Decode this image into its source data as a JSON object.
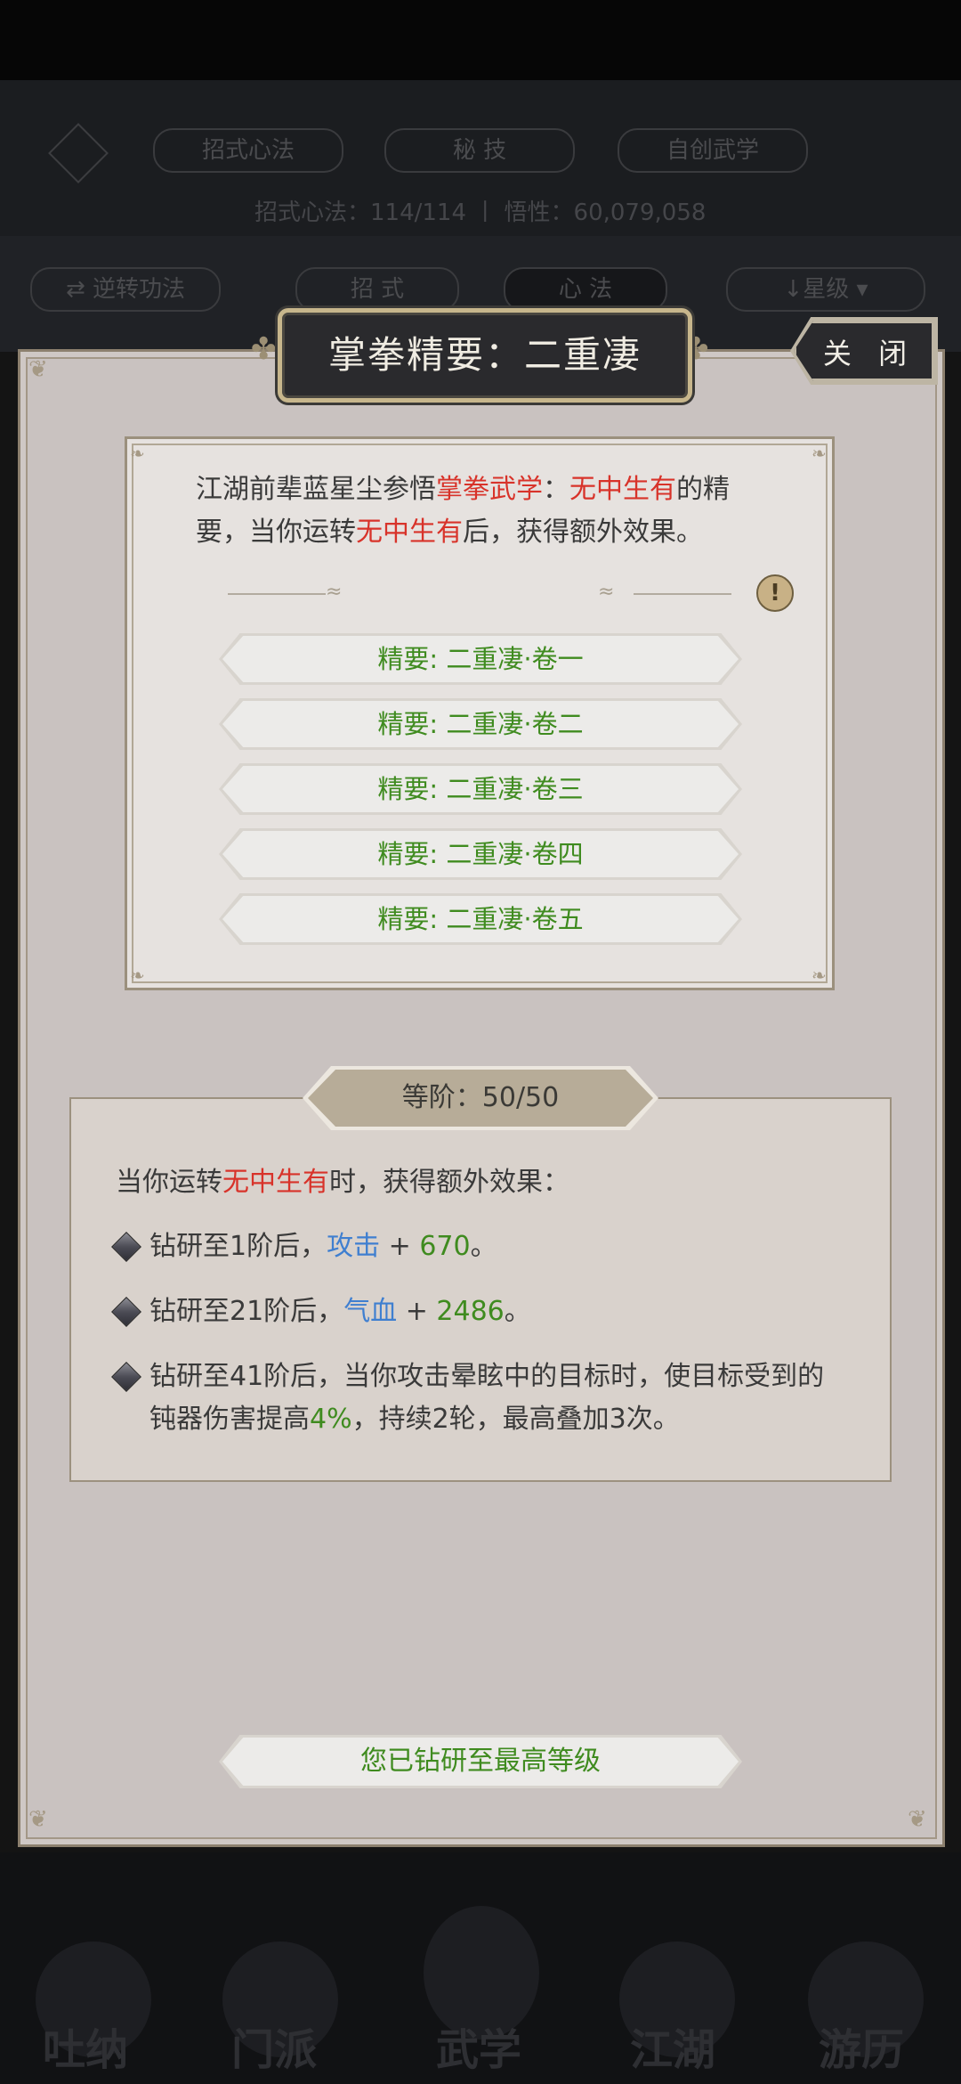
{
  "background": {
    "tabs": [
      "招式心法",
      "秘 技",
      "自创武学"
    ],
    "stats": "招式心法：114/114 丨 悟性：60,079,058",
    "toolbar": {
      "reverse": "逆转功法",
      "tab_moves": "招 式",
      "tab_heart": "心 法",
      "sort": "↓星级"
    },
    "nav": [
      "吐纳",
      "门派",
      "武学",
      "江湖",
      "游历"
    ]
  },
  "modal": {
    "title": "掌拳精要：二重凄",
    "close_label": "关 闭",
    "description": {
      "p1": "江湖前辈蓝星尘参悟",
      "p2": "掌拳武学",
      "p3": "：",
      "p4": "无中生有",
      "p5": "的精要，当你运转",
      "p6": "无中生有",
      "p7": "后，获得额外效果。"
    },
    "scrolls": [
      "精要: 二重凄·卷一",
      "精要: 二重凄·卷二",
      "精要: 二重凄·卷三",
      "精要: 二重凄·卷四",
      "精要: 二重凄·卷五"
    ],
    "level_label": "等阶：50/50",
    "effect_intro": {
      "p1": "当你运转",
      "p2": "无中生有",
      "p3": "时，获得额外效果："
    },
    "effects": [
      {
        "prefix": "钻研至1阶后，",
        "stat": "攻击",
        "plus": " + ",
        "value": "670",
        "suffix": "。"
      },
      {
        "prefix": "钻研至21阶后，",
        "stat": "气血",
        "plus": " + ",
        "value": "2486",
        "suffix": "。"
      }
    ],
    "effect3": {
      "p1": "钻研至41阶后，当你攻击晕眩中的目标时，使目标受到的钝器伤害提高",
      "p2": "4%",
      "p3": "，持续2轮，最高叠加3次。"
    },
    "max_level": "您已钻研至最高等级"
  },
  "colors": {
    "highlight_red": "#d8332a",
    "stat_blue": "#3f7fd0",
    "value_green": "#3f8b1f"
  }
}
